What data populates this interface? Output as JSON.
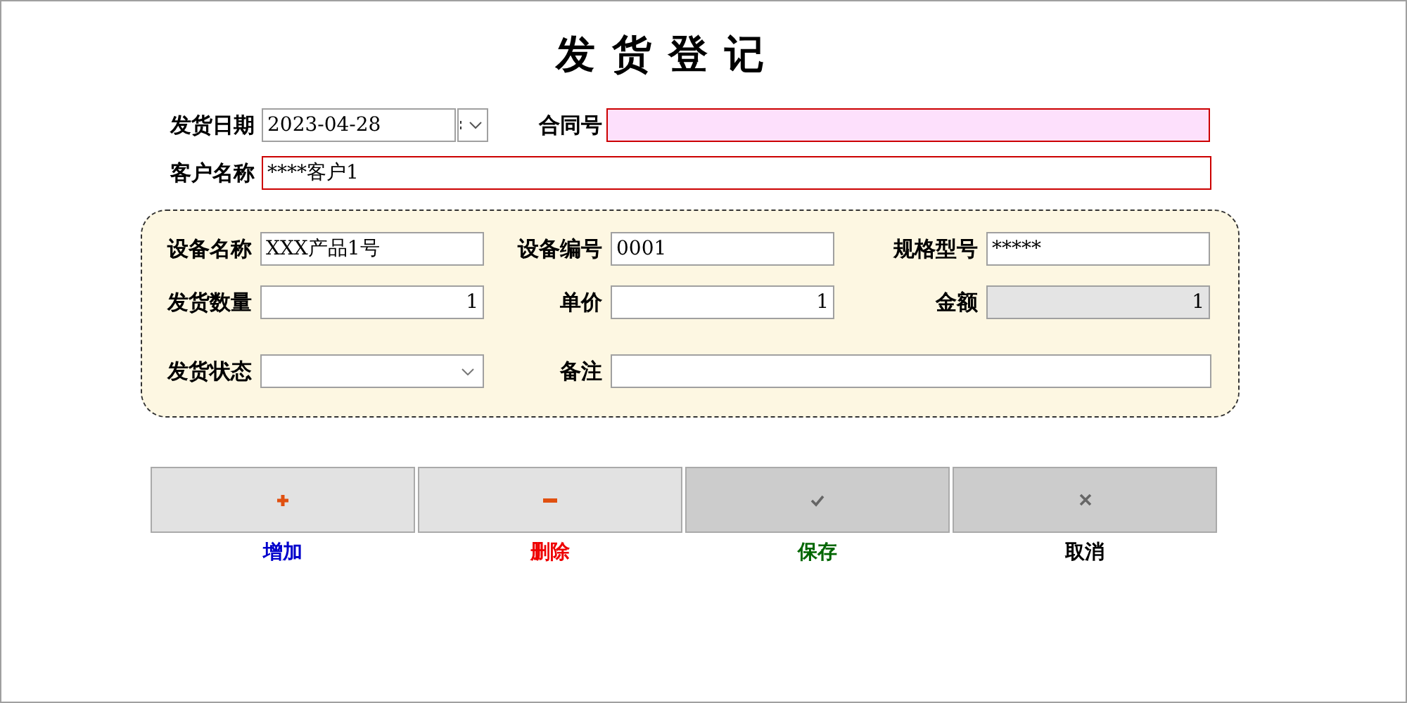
{
  "title": "发货登记",
  "header_rows": [
    [
      {
        "label": "发货日期",
        "value": "2023-04-28",
        "kind": "date",
        "required": false,
        "highlighted": false
      },
      {
        "label": "合同号",
        "kind": "text",
        "required": true,
        "highlighted": true
      }
    ],
    [
      {
        "label": "客户名称",
        "value": "****客户1",
        "kind": "wide",
        "required": true,
        "highlighted": false
      }
    ]
  ],
  "detail_rows": [
    [
      {
        "label": "设备名称",
        "value": "XXX产品1号",
        "kind": "text"
      },
      {
        "label": "设备编号",
        "value": "0001",
        "kind": "text"
      },
      {
        "label": "规格型号",
        "value": "*****",
        "kind": "text"
      }
    ],
    [
      {
        "label": "发货数量",
        "value": "1",
        "kind": "number"
      },
      {
        "label": "单价",
        "value": "1",
        "kind": "number"
      },
      {
        "label": "金额",
        "value": "1",
        "kind": "readonly"
      }
    ],
    [
      {
        "label": "发货状态",
        "kind": "select"
      },
      {
        "label": "备注",
        "kind": "wide"
      }
    ]
  ],
  "buttons": [
    {
      "label": "增加",
      "kind": "add",
      "color": "#0000cc",
      "disabled": false
    },
    {
      "label": "删除",
      "kind": "remove",
      "color": "#ee0000",
      "disabled": false
    },
    {
      "label": "保存",
      "kind": "save",
      "color": "#006600",
      "disabled": true
    },
    {
      "label": "取消",
      "kind": "cancel",
      "color": "#000000",
      "disabled": true
    }
  ]
}
